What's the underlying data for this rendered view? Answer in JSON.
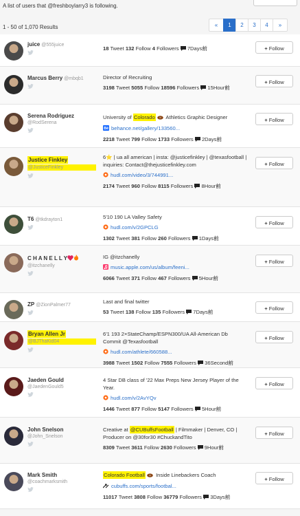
{
  "intro": "A list of users that @freshboylarry3 is following.",
  "results": "1 - 50 of 1,070 Results",
  "pager": {
    "first": "«",
    "pages": [
      "1",
      "2",
      "3",
      "4"
    ],
    "last": "»",
    "active": "1"
  },
  "follow_label": "Follow",
  "users": [
    {
      "name": "juice",
      "handle": "@555juice",
      "bio_lines": [],
      "tweets": "18",
      "follows": "132",
      "followers": "4",
      "ago": "7Days前"
    },
    {
      "name": "Marcus Berry",
      "handle": "@mbqb1",
      "bio_lines": [
        "Director of Recruiting"
      ],
      "tweets": "3198",
      "follows": "5055",
      "followers": "18596",
      "ago": "15Hour前"
    },
    {
      "name": "Serena Rodriguez",
      "handle": "@RodSerena",
      "bio_pre": "University of ",
      "bio_hl": "Colorado",
      "bio_post": " Athletics Graphic Designer",
      "link_icon": "behance-icon",
      "link": "behance.net/gallery/133560...",
      "tweets": "2218",
      "follows": "799",
      "followers": "1733",
      "ago": "2Days前"
    },
    {
      "name": "Justice Finkley",
      "handle": "@JusticeFinkley",
      "bio": "6⭐ | ua all american | insta: @justicefinkley | @texasfootball | inquiries: Contact@thejusticefinkley.com",
      "link_icon": "hudl-icon",
      "link": "hudl.com/video/3/744991...",
      "tweets": "2174",
      "follows": "960",
      "followers": "8115",
      "ago": "8Hour前"
    },
    {
      "name": "T6",
      "handle": "@tkdrayton1",
      "bio": "5'10 190 LA Valley Safety",
      "link_icon": "hudl-icon",
      "link": "hudl.com/v/2GPCLG",
      "tweets": "1302",
      "follows": "381",
      "followers": "260",
      "ago": "1Days前"
    },
    {
      "name": "C H A N E L L Y",
      "handle": "@itzchanelly",
      "bio": "IG @itzchanelly",
      "link_icon": "music-icon",
      "link": "music.apple.com/us/album/feeni...",
      "tweets": "6066",
      "follows": "371",
      "followers": "467",
      "ago": "5Hour前"
    },
    {
      "name": "ZP",
      "handle": "@ZionPalmer77",
      "bio": "Last and final twitter",
      "tweets": "53",
      "follows": "138",
      "followers": "135",
      "ago": "7Days前"
    },
    {
      "name": "Bryan Allen Jr",
      "handle": "@BJThaKid04",
      "bio": "6'1 193 2×StateChamp/ESPN300/UA All-American Db Commit @Texasfootball",
      "link_icon": "hudl-icon",
      "link": "hudl.com/athlete/660588...",
      "tweets": "3988",
      "follows": "1502",
      "followers": "7555",
      "ago": "36Second前"
    },
    {
      "name": "Jaeden Gould",
      "handle": "@JaedenGould5",
      "bio": "4 Star DB class of '22 Max Preps New Jersey Player of the Year.",
      "link_icon": "hudl-icon",
      "link": "hudl.com/v/2AvYQv",
      "tweets": "1446",
      "follows": "877",
      "followers": "5147",
      "ago": "5Hour前"
    },
    {
      "name": "John Snelson",
      "handle": "@John_Snelson",
      "bio_pre": "Creative at ",
      "bio_hl": "@CUBuffsFootball",
      "bio_post": " | Filmmaker | Denver, CO | Producer on @30for30 #ChuckandTito",
      "tweets": "8309",
      "follows": "3611",
      "followers": "2630",
      "ago": "9Hour前"
    },
    {
      "name": "Mark Smith",
      "handle": "@coachmarksmith",
      "bio_pre": "",
      "bio_hl": "Colorado Football",
      "bio_post": " Inside Linebackers Coach",
      "link_icon": "link-icon",
      "link": "cubuffs.com/sports/footbal...",
      "tweets": "11017",
      "follows": "3808",
      "followers": "36779",
      "ago": "3Days前"
    }
  ],
  "labels": {
    "tweet": "Tweet",
    "follow": "Follow",
    "followers": "Followers"
  }
}
